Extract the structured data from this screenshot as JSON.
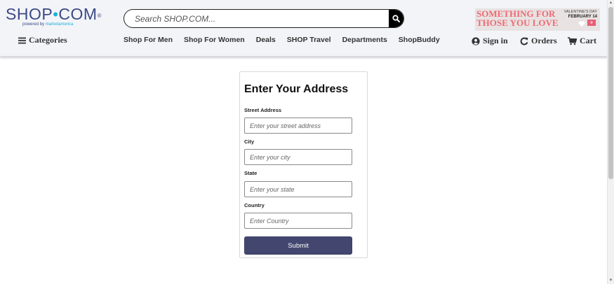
{
  "logo": {
    "name": "SHOP",
    "dot": "•",
    "tld": "COM",
    "reg": "®",
    "tagline_prefix": "powered by ",
    "tagline_brand": "marketamerica"
  },
  "search": {
    "placeholder": "Search SHOP.COM...",
    "value": ""
  },
  "categories": {
    "label": "Categories",
    "icon": "hamburger-icon"
  },
  "nav": [
    "Shop For Men",
    "Shop For Women",
    "Deals",
    "SHOP Travel",
    "Departments",
    "ShopBuddy"
  ],
  "promo": {
    "line1": "SOMETHING FOR",
    "line2": "THOSE YOU LOVE",
    "occasion": "VALENTINE'S DAY",
    "date": "FEBRUARY 14",
    "arrow": "»",
    "text_color": "#ee6b73"
  },
  "account": {
    "sign_in": "Sign in",
    "orders": "Orders",
    "cart": "Cart"
  },
  "form": {
    "title": "Enter Your Address",
    "fields": [
      {
        "label": "Street Address",
        "placeholder": "Enter your street address",
        "value": ""
      },
      {
        "label": "City",
        "placeholder": "Enter your city",
        "value": ""
      },
      {
        "label": "State",
        "placeholder": "Enter your state",
        "value": ""
      },
      {
        "label": "Country",
        "placeholder": "Enter Country",
        "value": ""
      }
    ],
    "submit_label": "Submit",
    "button_color": "#434770"
  },
  "colors": {
    "brand": "#3c4a86",
    "accent": "#1cb1d8",
    "header_bg": "#f3f4f8"
  }
}
